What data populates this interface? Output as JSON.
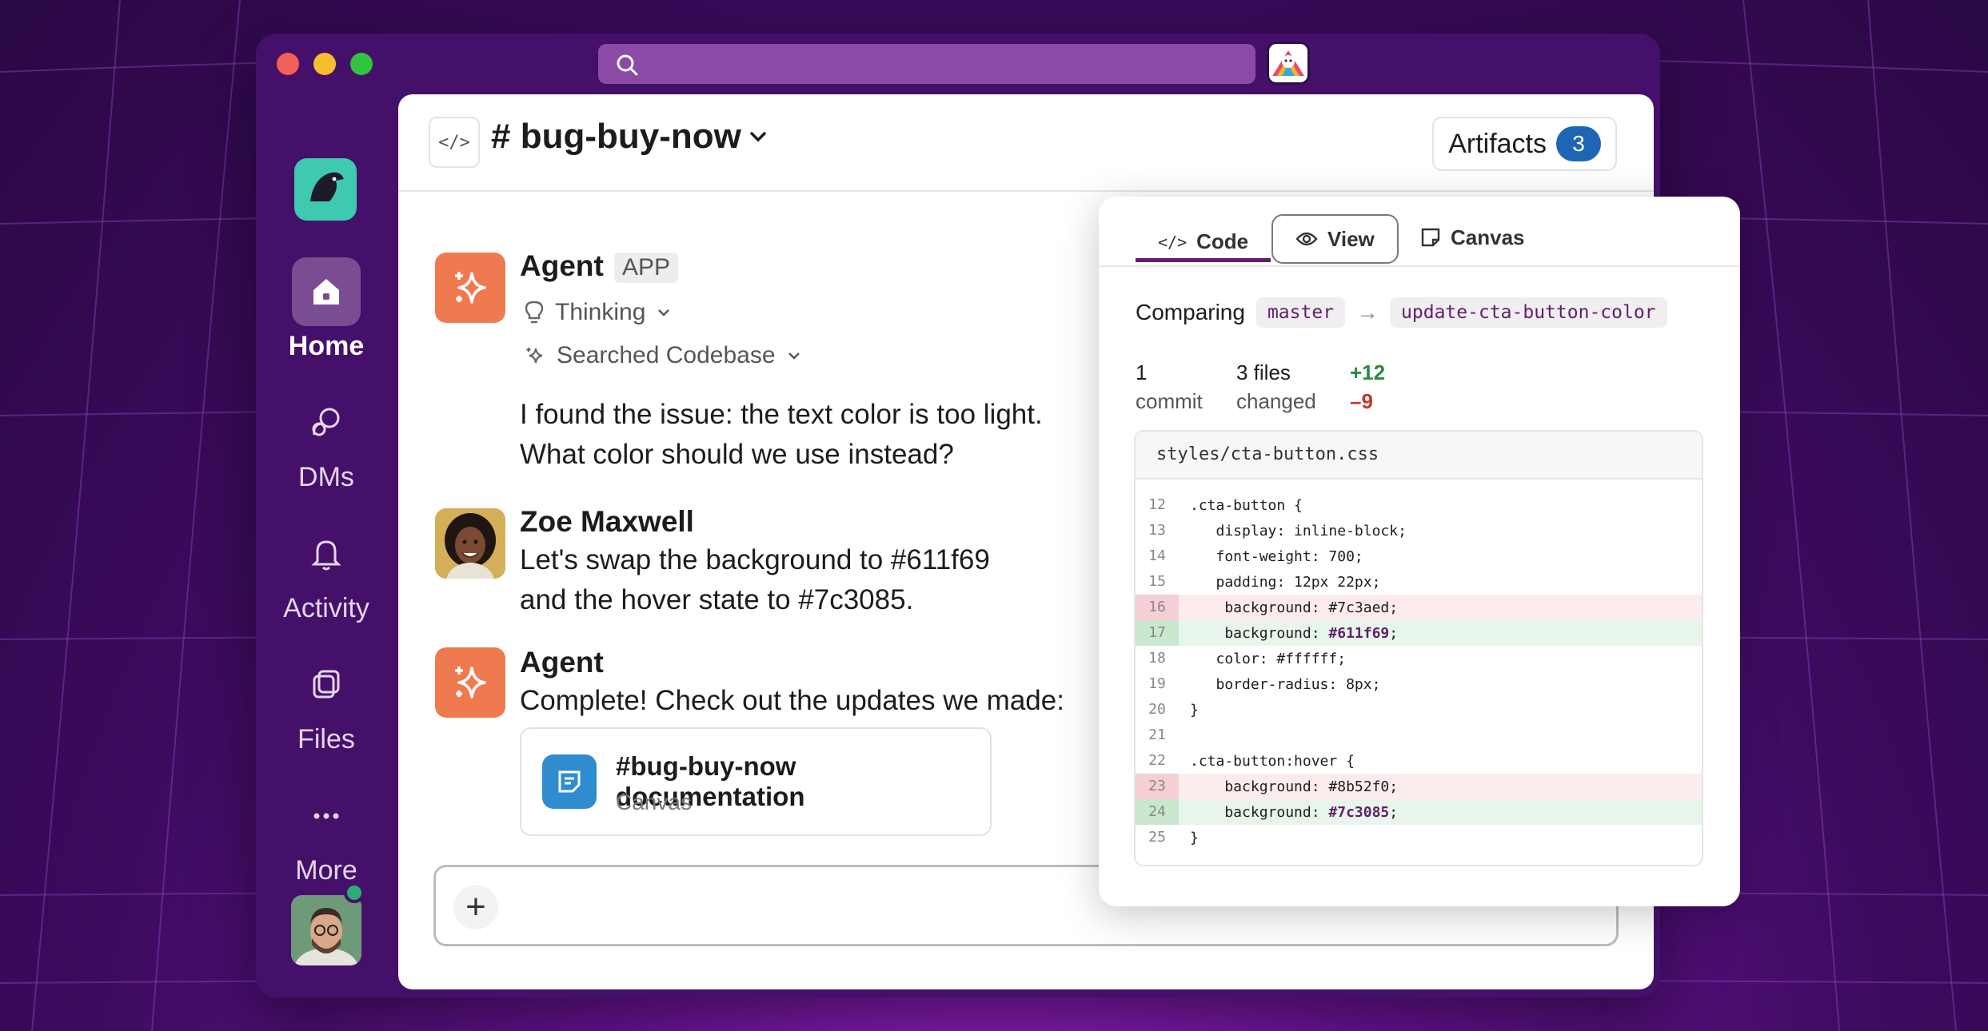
{
  "sidebar": {
    "items": [
      {
        "label": "Home"
      },
      {
        "label": "DMs"
      },
      {
        "label": "Activity"
      },
      {
        "label": "Files"
      },
      {
        "label": "More"
      }
    ]
  },
  "header": {
    "channel": "# bug-buy-now",
    "code_icon": "</>",
    "artifacts_label": "Artifacts",
    "artifacts_count": "3"
  },
  "messages": [
    {
      "name": "Agent",
      "tag": "APP",
      "thinking": "Thinking",
      "searched": "Searched Codebase",
      "line1": "I found the issue: the text color is too light.",
      "line2": "What color should we use instead?"
    },
    {
      "name": "Zoe Maxwell",
      "line1": "Let's swap the background to #611f69",
      "line2": "and the hover state to #7c3085."
    },
    {
      "name": "Agent",
      "line1": "Complete! Check out the updates we made:",
      "card": {
        "title": "#bug-buy-now documentation",
        "subtitle": "Canvas"
      }
    }
  ],
  "panel": {
    "tabs": [
      "Code",
      "View",
      "Canvas"
    ],
    "comparing": "Comparing",
    "arrow": "→",
    "base": "master",
    "head": "update-cta-button-color",
    "commits_num": "1",
    "commits_label": "commit",
    "files_num": "3 files",
    "files_label": "changed",
    "additions": "+12",
    "deletions": "–9",
    "file": "styles/cta-button.css",
    "lines": [
      {
        "n": "12",
        "t": ".cta-button {",
        "k": ""
      },
      {
        "n": "13",
        "t": "   display: inline-block;",
        "k": ""
      },
      {
        "n": "14",
        "t": "   font-weight: 700;",
        "k": ""
      },
      {
        "n": "15",
        "t": "   padding: 12px 22px;",
        "k": ""
      },
      {
        "n": "16",
        "t": "    background: #7c3aed;",
        "k": "del"
      },
      {
        "n": "17",
        "t": "    background: ",
        "h": "#611f69",
        "e": ";",
        "k": "add"
      },
      {
        "n": "18",
        "t": "   color: #ffffff;",
        "k": ""
      },
      {
        "n": "19",
        "t": "   border-radius: 8px;",
        "k": ""
      },
      {
        "n": "20",
        "t": "}",
        "k": ""
      },
      {
        "n": "21",
        "t": "",
        "k": ""
      },
      {
        "n": "22",
        "t": ".cta-button:hover {",
        "k": ""
      },
      {
        "n": "23",
        "t": "    background: #8b52f0;",
        "k": "del"
      },
      {
        "n": "24",
        "t": "    background: ",
        "h": "#7c3085",
        "e": ";",
        "k": "add"
      },
      {
        "n": "25",
        "t": "}",
        "k": ""
      }
    ]
  },
  "colors": {
    "accent": "#611f69",
    "rail": "#45106a",
    "agent": "#f07a50",
    "badge": "#1f65b5"
  }
}
